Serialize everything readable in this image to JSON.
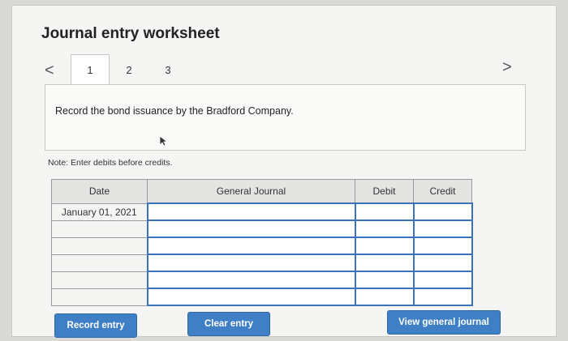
{
  "worksheet": {
    "title": "Journal entry worksheet",
    "tabs": [
      {
        "label": "1",
        "active": true
      },
      {
        "label": "2",
        "active": false
      },
      {
        "label": "3",
        "active": false
      }
    ],
    "prev_icon": "<",
    "next_icon": ">"
  },
  "question": {
    "text": "Record the bond issuance by the Bradford Company."
  },
  "note": {
    "label": "Note:",
    "text": "Enter debits before credits."
  },
  "journal": {
    "columns": [
      "Date",
      "General Journal",
      "Debit",
      "Credit"
    ],
    "rows": [
      {
        "date": "January 01, 2021"
      },
      {
        "date": ""
      },
      {
        "date": ""
      },
      {
        "date": ""
      },
      {
        "date": ""
      },
      {
        "date": ""
      }
    ]
  },
  "buttons": {
    "record_label": "Record entry",
    "clear_label": "Clear entry",
    "view_label": "View general journal"
  },
  "colors": {
    "button_blue": "#3f7fc6",
    "input_border": "#3b72b8"
  }
}
